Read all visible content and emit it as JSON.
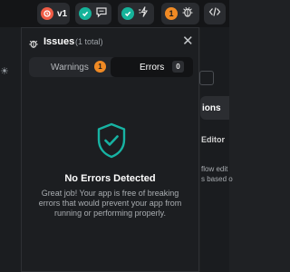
{
  "toolbar": {
    "version_label": "v1",
    "issue_count": "1",
    "colors": {
      "version": "#ef5b45",
      "status_ok": "#16b39a",
      "issues": "#f08a24"
    },
    "icons": [
      "version-icon",
      "check-icon",
      "chat-icon",
      "deploy-icon",
      "bug-icon",
      "code-icon"
    ]
  },
  "background": {
    "tab_label": "ions",
    "editor_label": "Editor",
    "line1": "flow edit",
    "line2": "s based o"
  },
  "issues_panel": {
    "title": "Issues",
    "count_text": "(1 total)",
    "tabs": [
      {
        "label": "Warnings",
        "count": "1",
        "selected": false
      },
      {
        "label": "Errors",
        "count": "0",
        "selected": true
      }
    ],
    "empty_state": {
      "title": "No Errors Detected",
      "description": "Great job! Your app is free of breaking errors that would prevent your app from running or performing properly.",
      "icon": "shield-check-icon",
      "accent": "#17b3a3"
    }
  }
}
